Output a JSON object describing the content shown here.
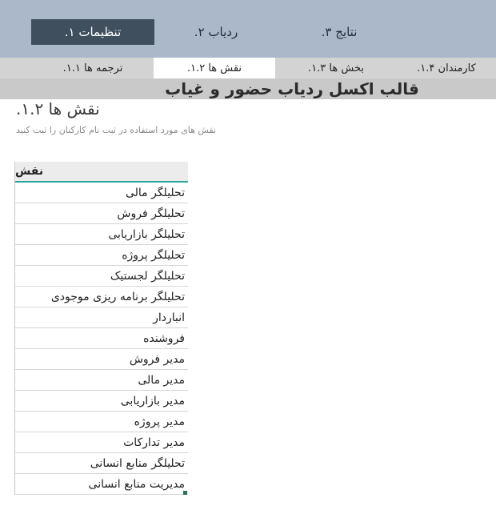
{
  "top_tabs": [
    {
      "label": "تنظیمات ۱.",
      "active": true
    },
    {
      "label": "ردیاب ۲.",
      "active": false
    },
    {
      "label": "نتایج ۳.",
      "active": false
    }
  ],
  "sub_tabs": [
    {
      "label": "ترجمه ها ۱.۱.",
      "active": false
    },
    {
      "label": "نقش ها ۱.۲.",
      "active": true
    },
    {
      "label": "بخش ها ۱.۳.",
      "active": false
    },
    {
      "label": "کارمندان ۱.۴.",
      "active": false
    }
  ],
  "banner": {
    "title": "قالب اکسل ردیاب حضور و غیاب"
  },
  "section": {
    "title": "نقش ها ۱.۲.",
    "subtitle": "نقش های مورد استفاده در ثبت نام کارکنان را ثبت کنید"
  },
  "roles_table": {
    "header": "نقش",
    "rows": [
      "تحلیلگر مالی",
      "تحلیلگر فروش",
      "تحلیلگر بازاریابی",
      "تحلیلگر پروژه",
      "تحلیلگر لجستیک",
      "تحلیلگر برنامه ریزی موجودی",
      "انباردار",
      "فروشنده",
      "مدیر فروش",
      "مدیر مالی",
      "مدیر بازاریابی",
      "مدیر پروژه",
      "مدیر تدارکات",
      "تحلیلگر منابع انسانی",
      "مدیریت منابع انسانی"
    ]
  },
  "colors": {
    "top_nav_bg": "#aab8c9",
    "active_tab_bg": "#3f4f5e",
    "table_header_underline": "#2aa59a"
  }
}
